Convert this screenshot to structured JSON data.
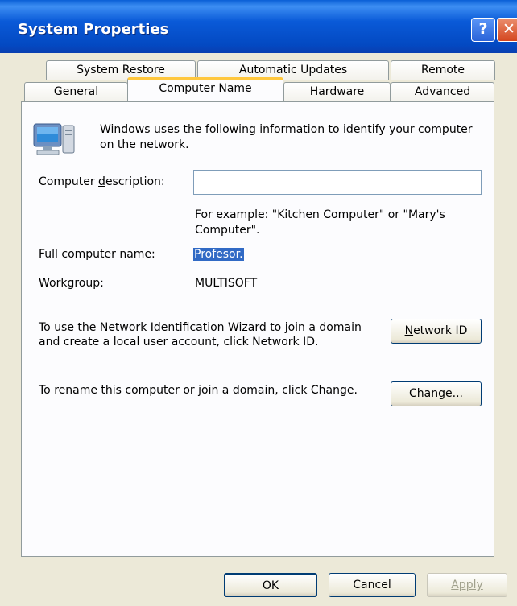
{
  "window": {
    "title": "System Properties",
    "help_label": "?",
    "close_label": "✕"
  },
  "tabs_row1": [
    "System Restore",
    "Automatic Updates",
    "Remote"
  ],
  "tabs_row2": [
    "General",
    "Computer Name",
    "Hardware",
    "Advanced"
  ],
  "selected_tab": "Computer Name",
  "panel": {
    "intro_text": "Windows uses the following information to identify your computer on the network.",
    "description_label_pre": "Computer ",
    "description_label_mnemonic": "d",
    "description_label_post": "escription:",
    "description_value": "",
    "example_text": "For example: \"Kitchen Computer\" or \"Mary's Computer\".",
    "full_name_label": "Full computer name:",
    "full_name_value": "Profesor.",
    "workgroup_label": "Workgroup:",
    "workgroup_value": "MULTISOFT",
    "network_id_text": "To use the Network Identification Wizard to join a domain and create a local user account, click Network ID.",
    "network_id_button_mnemonic": "N",
    "network_id_button_rest": "etwork ID",
    "change_text": "To rename this computer or join a domain, click Change.",
    "change_button_mnemonic": "C",
    "change_button_rest": "hange..."
  },
  "footer": {
    "ok_label": "OK",
    "cancel_label": "Cancel",
    "apply_label": "Apply"
  },
  "colors": {
    "titlebar": "#0a5ad8",
    "selected_tab_accent": "#ffc73c",
    "selection": "#316ac5",
    "dialog_bg": "#ece9d8"
  },
  "icons": [
    "help-icon",
    "close-icon",
    "computer-icon"
  ]
}
